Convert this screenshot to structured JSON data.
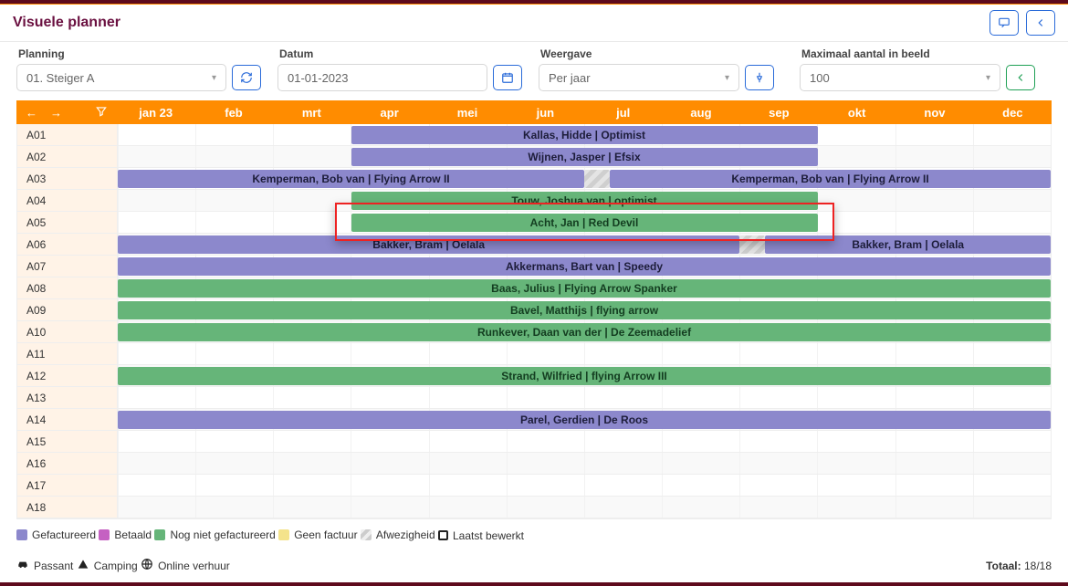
{
  "title": "Visuele planner",
  "filters": {
    "planning": {
      "label": "Planning",
      "value": "01. Steiger A"
    },
    "datum": {
      "label": "Datum",
      "value": "01-01-2023"
    },
    "weergave": {
      "label": "Weergave",
      "value": "Per jaar"
    },
    "max": {
      "label": "Maximaal aantal in beeld",
      "value": "100"
    }
  },
  "months": [
    "jan 23",
    "feb",
    "mrt",
    "apr",
    "mei",
    "jun",
    "jul",
    "aug",
    "sep",
    "okt",
    "nov",
    "dec"
  ],
  "rows": [
    {
      "label": "A01",
      "bars": [
        {
          "start": 3,
          "span": 6,
          "color": "purple",
          "text": "Kallas, Hidde | Optimist"
        }
      ]
    },
    {
      "label": "A02",
      "bars": [
        {
          "start": 3,
          "span": 6,
          "color": "purple",
          "text": "Wijnen, Jasper | Efsix"
        }
      ]
    },
    {
      "label": "A03",
      "bars": [
        {
          "start": 0,
          "span": 6,
          "color": "purple",
          "text": "Kemperman, Bob van | Flying Arrow II",
          "align": "center-track"
        },
        {
          "start": 6,
          "span": 0.33,
          "color": "hatched",
          "text": ""
        },
        {
          "start": 6.33,
          "span": 5.67,
          "color": "purple",
          "text": "Kemperman, Bob van | Flying Arrow II"
        }
      ]
    },
    {
      "label": "A04",
      "bars": [
        {
          "start": 3,
          "span": 6,
          "color": "green",
          "text": "Touw, Joshua van | optimist"
        }
      ],
      "highlight_below": true
    },
    {
      "label": "A05",
      "bars": [
        {
          "start": 3,
          "span": 6,
          "color": "green",
          "text": "Acht, Jan | Red Devil"
        }
      ],
      "highlight": true
    },
    {
      "label": "A06",
      "bars": [
        {
          "start": 0,
          "span": 8,
          "color": "purple",
          "text": "Bakker, Bram | Oelala"
        },
        {
          "start": 8,
          "span": 0.33,
          "color": "hatched",
          "text": ""
        },
        {
          "start": 8.33,
          "span": 3.67,
          "color": "purple",
          "text": "Bakker, Bram | Oelala"
        }
      ]
    },
    {
      "label": "A07",
      "bars": [
        {
          "start": 0,
          "span": 12,
          "color": "purple",
          "text": "Akkermans, Bart van | Speedy"
        }
      ]
    },
    {
      "label": "A08",
      "bars": [
        {
          "start": 0,
          "span": 12,
          "color": "green",
          "text": "Baas, Julius | Flying Arrow Spanker"
        }
      ]
    },
    {
      "label": "A09",
      "bars": [
        {
          "start": 0,
          "span": 12,
          "color": "green",
          "text": "Bavel, Matthijs | flying arrow"
        }
      ]
    },
    {
      "label": "A10",
      "bars": [
        {
          "start": 0,
          "span": 12,
          "color": "green",
          "text": "Runkever, Daan van der | De Zeemadelief"
        }
      ]
    },
    {
      "label": "A11",
      "bars": []
    },
    {
      "label": "A12",
      "bars": [
        {
          "start": 0,
          "span": 12,
          "color": "green",
          "text": "Strand, Wilfried | flying Arrow III"
        }
      ]
    },
    {
      "label": "A13",
      "bars": []
    },
    {
      "label": "A14",
      "bars": [
        {
          "start": 0,
          "span": 12,
          "color": "purple",
          "text": "Parel, Gerdien | De Roos"
        }
      ]
    },
    {
      "label": "A15",
      "bars": []
    },
    {
      "label": "A16",
      "bars": []
    },
    {
      "label": "A17",
      "bars": []
    },
    {
      "label": "A18",
      "bars": []
    }
  ],
  "legend": {
    "items": [
      {
        "swatch": "purple",
        "label": "Gefactureerd"
      },
      {
        "swatch": "magenta",
        "label": "Betaald"
      },
      {
        "swatch": "green",
        "label": "Nog niet gefactureerd"
      },
      {
        "swatch": "yellow",
        "label": "Geen factuur"
      },
      {
        "swatch": "hatched",
        "label": "Afwezigheid"
      },
      {
        "swatch": "outline",
        "label": "Laatst bewerkt"
      }
    ],
    "icons": [
      {
        "icon": "car",
        "label": "Passant"
      },
      {
        "icon": "tent",
        "label": "Camping"
      },
      {
        "icon": "globe",
        "label": "Online verhuur"
      }
    ],
    "total_label": "Totaal:",
    "total_value": "18/18"
  },
  "highlight_row_index": 4
}
